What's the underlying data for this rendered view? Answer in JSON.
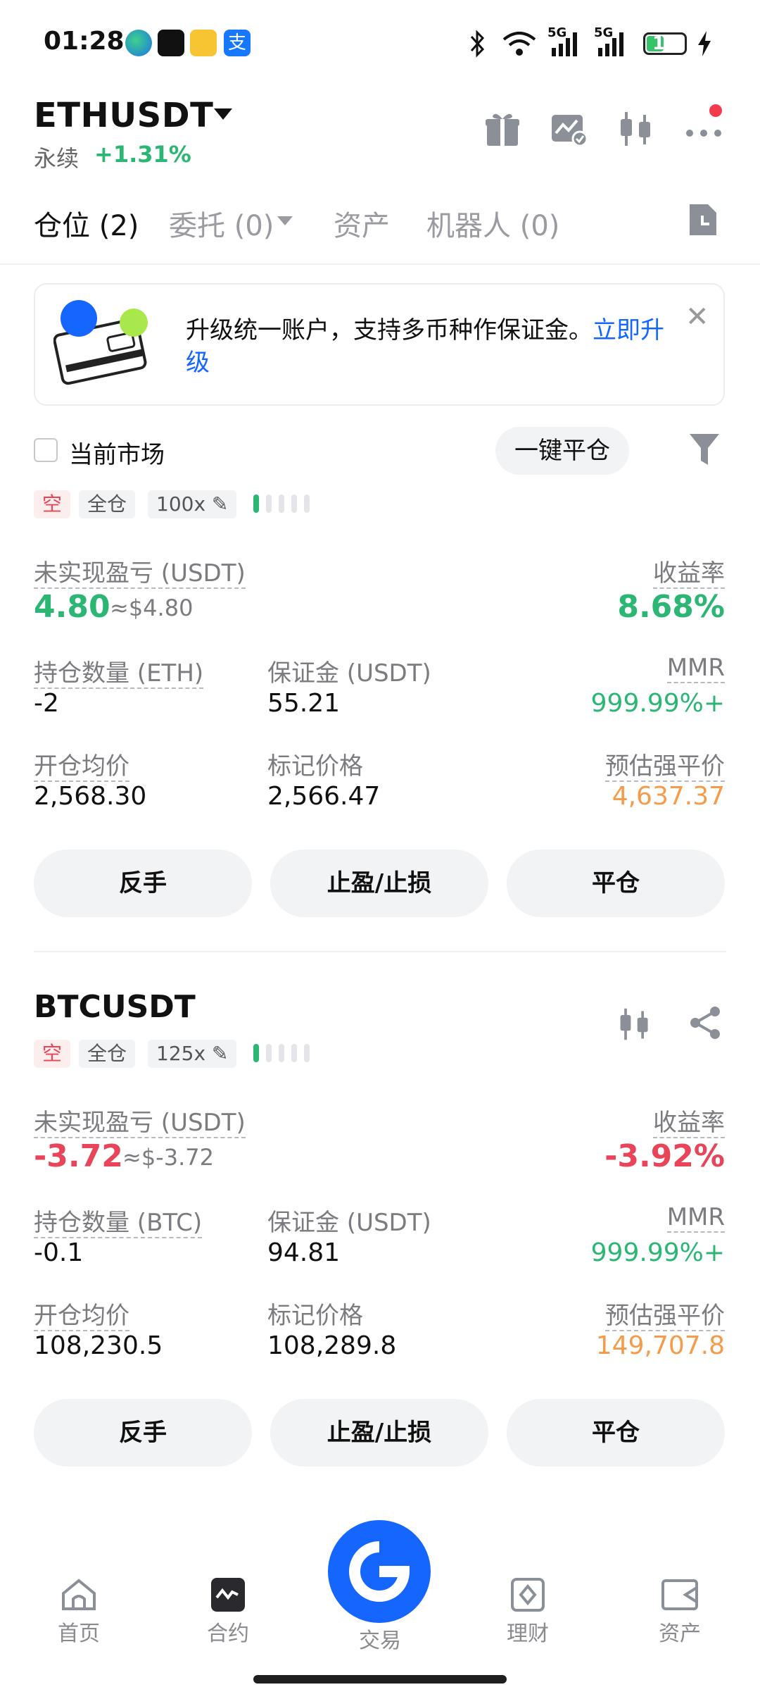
{
  "status": {
    "time": "01:28",
    "battery": "12",
    "network_1": "5G",
    "network_2": "5G"
  },
  "header": {
    "title": "ETHUSDT",
    "subtitle": "永续",
    "change": "+1.31%"
  },
  "tabs": [
    {
      "label": "仓位 (2)"
    },
    {
      "label": "委托 (0)"
    },
    {
      "label": "资产"
    },
    {
      "label": "机器人 (0)"
    }
  ],
  "banner": {
    "text": "升级统一账户，支持多币种作保证金。",
    "link": "立即升级"
  },
  "filter": {
    "current_market": "当前市场",
    "close_all": "一键平仓"
  },
  "positions": [
    {
      "symbol": "ETHUSDT",
      "side": "空",
      "margin_mode": "全仓",
      "leverage": "100x",
      "pnl_label": "未实现盈亏 (USDT)",
      "pnl": "4.80",
      "pnl_approx": "≈$4.80",
      "roe_label": "收益率",
      "roe": "8.68%",
      "qty_label": "持仓数量 (ETH)",
      "qty": "-2",
      "margin_label": "保证金 (USDT)",
      "margin": "55.21",
      "mmr_label": "MMR",
      "mmr": "999.99%+",
      "entry_label": "开仓均价",
      "entry": "2,568.30",
      "mark_label": "标记价格",
      "mark": "2,566.47",
      "liq_label": "预估强平价",
      "liq": "4,637.37",
      "btn_reverse": "反手",
      "btn_tpsl": "止盈/止损",
      "btn_close": "平仓",
      "leverage_level": 1
    },
    {
      "symbol": "BTCUSDT",
      "side": "空",
      "margin_mode": "全仓",
      "leverage": "125x",
      "pnl_label": "未实现盈亏 (USDT)",
      "pnl": "-3.72",
      "pnl_approx": "≈$-3.72",
      "roe_label": "收益率",
      "roe": "-3.92%",
      "qty_label": "持仓数量 (BTC)",
      "qty": "-0.1",
      "margin_label": "保证金 (USDT)",
      "margin": "94.81",
      "mmr_label": "MMR",
      "mmr": "999.99%+",
      "entry_label": "开仓均价",
      "entry": "108,230.5",
      "mark_label": "标记价格",
      "mark": "108,289.8",
      "liq_label": "预估强平价",
      "liq": "149,707.8",
      "btn_reverse": "反手",
      "btn_tpsl": "止盈/止损",
      "btn_close": "平仓",
      "leverage_level": 1
    }
  ],
  "nav": [
    {
      "label": "首页"
    },
    {
      "label": "合约"
    },
    {
      "label": "交易"
    },
    {
      "label": "理财"
    },
    {
      "label": "资产"
    }
  ],
  "colors": {
    "accent": "#1565ff",
    "profit": "#2bb673",
    "loss": "#e8455a",
    "liq": "#f59b4a"
  }
}
